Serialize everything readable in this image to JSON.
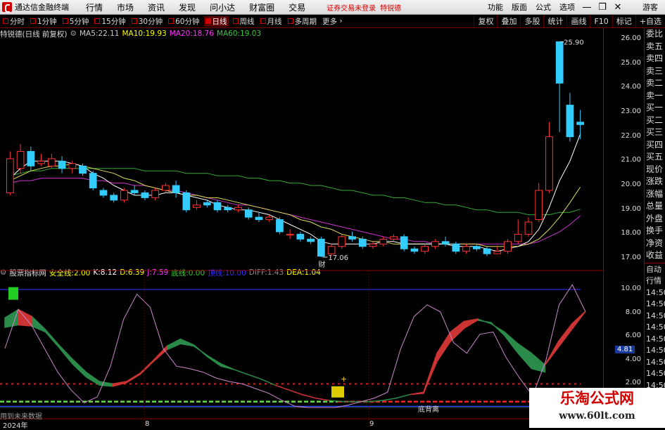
{
  "app": {
    "title": "通达信金融终端"
  },
  "menu": [
    "行情",
    "市场",
    "资讯",
    "发现",
    "问小达",
    "财富圈",
    "交易"
  ],
  "login_status": "证券交易未登录",
  "stock_name_top": "特锐德",
  "right_menu": [
    "功能",
    "版面",
    "公式",
    "选项"
  ],
  "window_buttons": [
    "—",
    "❐",
    "✕"
  ],
  "guest": "游客",
  "toolbar": {
    "periods": [
      "分时",
      "1分钟",
      "5分钟",
      "15分钟",
      "30分钟",
      "60分钟",
      "日线",
      "周线",
      "月线",
      "多周期",
      "更多"
    ],
    "active": "日线",
    "right": [
      "复权",
      "叠加",
      "多股",
      "统计",
      "画线",
      "F10",
      "标记",
      "+自选"
    ]
  },
  "info": {
    "stock": "特锐德(日线 前复权)",
    "ma": [
      {
        "label": "MA5:",
        "value": "22.11",
        "color": "#ffffff"
      },
      {
        "label": "MA10:",
        "value": "19.93",
        "color": "#ffff00"
      },
      {
        "label": "MA20:",
        "value": "18.76",
        "color": "#ff33ff"
      },
      {
        "label": "MA60:",
        "value": "19.03",
        "color": "#33cc33"
      }
    ]
  },
  "sub_info": {
    "name": "股票指标网",
    "items": [
      {
        "label": "安全线:",
        "value": "2.00",
        "color": "#ffff00"
      },
      {
        "label": "K:",
        "value": "8.12",
        "color": "#ffffff"
      },
      {
        "label": "D:",
        "value": "6.39",
        "color": "#ffff00"
      },
      {
        "label": "J:",
        "value": "7.59",
        "color": "#ff33ff"
      },
      {
        "label": "底线:",
        "value": "0.00",
        "color": "#33cc33"
      },
      {
        "label": "顶线:",
        "value": "10.00",
        "color": "#3333ff"
      },
      {
        "label": "DIFF:",
        "value": "1.43",
        "color": "#888888"
      },
      {
        "label": "DEA:",
        "value": "1.04",
        "color": "#ffff00"
      }
    ]
  },
  "price_axis": [
    "26.00",
    "25.00",
    "24.00",
    "23.00",
    "22.00",
    "21.00",
    "20.00",
    "19.00",
    "18.00",
    "17.00"
  ],
  "indicator_axis": [
    "10.00",
    "8.00",
    "6.00",
    "4.00",
    "2.00"
  ],
  "current_value_badge": "4.81",
  "annotations": {
    "high": "25.90",
    "low": "17.06",
    "marker": "财",
    "divergence": "底背离",
    "bottom_note": "用到未来数据",
    "year": "2024年",
    "month_labels": [
      "8",
      "9"
    ]
  },
  "sidebar_labels": [
    "委比",
    "卖五",
    "卖四",
    "卖三",
    "卖二",
    "卖一",
    "买一",
    "买二",
    "买三",
    "买四",
    "买五",
    "现价",
    "涨跌",
    "涨幅",
    "总量",
    "外盘",
    "换手",
    "净资",
    "收益"
  ],
  "sidebar_times": [
    "自动",
    "行情",
    "14:50",
    "14:50",
    "14:50",
    "14:50",
    "14:50",
    "14:50",
    "14:50",
    "14:50",
    "14:50"
  ],
  "watermark": {
    "title": "乐淘公式网",
    "url": "www.60lt.com"
  },
  "chart_data": {
    "type": "candlestick",
    "y_range": [
      16.8,
      26.3
    ],
    "candles": [
      [
        19.7,
        21.1,
        21.4,
        19.6
      ],
      [
        20.7,
        21.4,
        21.7,
        20.5
      ],
      [
        21.4,
        20.8,
        21.6,
        20.6
      ],
      [
        20.9,
        21.0,
        21.3,
        20.8
      ],
      [
        20.8,
        21.1,
        21.3,
        20.7
      ],
      [
        21.0,
        20.7,
        21.2,
        20.5
      ],
      [
        20.7,
        20.9,
        21.0,
        20.5
      ],
      [
        20.8,
        20.5,
        20.9,
        20.4
      ],
      [
        20.5,
        19.9,
        20.6,
        19.8
      ],
      [
        19.8,
        19.6,
        19.9,
        19.5
      ],
      [
        19.6,
        19.4,
        19.7,
        19.3
      ],
      [
        19.4,
        19.8,
        19.9,
        19.3
      ],
      [
        19.8,
        19.7,
        20.0,
        19.6
      ],
      [
        19.7,
        19.5,
        19.8,
        19.4
      ],
      [
        19.5,
        19.8,
        19.9,
        19.4
      ],
      [
        19.8,
        20.0,
        20.1,
        19.7
      ],
      [
        20.0,
        19.7,
        20.2,
        19.5
      ],
      [
        19.7,
        19.0,
        19.8,
        18.9
      ],
      [
        19.1,
        19.2,
        19.4,
        19.0
      ],
      [
        19.3,
        19.2,
        19.4,
        19.1
      ],
      [
        19.3,
        19.0,
        19.4,
        18.9
      ],
      [
        19.1,
        19.0,
        19.2,
        18.9
      ],
      [
        19.0,
        19.1,
        19.2,
        18.9
      ],
      [
        19.0,
        18.7,
        19.1,
        18.6
      ],
      [
        18.7,
        18.6,
        18.9,
        18.5
      ],
      [
        18.6,
        18.7,
        18.8,
        18.5
      ],
      [
        18.6,
        18.1,
        18.7,
        18.0
      ],
      [
        18.0,
        18.0,
        18.2,
        17.8
      ],
      [
        18.0,
        17.8,
        18.1,
        17.7
      ],
      [
        17.8,
        17.7,
        17.9,
        17.6
      ],
      [
        17.8,
        17.1,
        17.9,
        17.06
      ],
      [
        17.2,
        17.5,
        17.6,
        17.1
      ],
      [
        17.5,
        17.9,
        18.0,
        17.4
      ],
      [
        17.9,
        17.8,
        18.1,
        17.7
      ],
      [
        17.8,
        17.5,
        17.9,
        17.4
      ],
      [
        17.5,
        17.6,
        17.7,
        17.4
      ],
      [
        17.6,
        17.8,
        17.9,
        17.5
      ],
      [
        17.8,
        17.9,
        18.0,
        17.7
      ],
      [
        17.9,
        17.4,
        18.0,
        17.3
      ],
      [
        17.4,
        17.3,
        17.5,
        17.2
      ],
      [
        17.3,
        17.5,
        17.6,
        17.2
      ],
      [
        17.5,
        17.7,
        17.8,
        17.4
      ],
      [
        17.7,
        17.6,
        17.9,
        17.5
      ],
      [
        17.6,
        17.3,
        17.7,
        17.2
      ],
      [
        17.3,
        17.5,
        17.6,
        17.2
      ],
      [
        17.5,
        17.4,
        17.6,
        17.3
      ],
      [
        17.4,
        17.2,
        17.5,
        17.1
      ],
      [
        17.2,
        17.3,
        17.5,
        17.2
      ],
      [
        17.3,
        17.7,
        17.8,
        17.2
      ],
      [
        17.7,
        18.0,
        18.6,
        17.6
      ],
      [
        18.0,
        18.5,
        18.7,
        17.9
      ],
      [
        18.6,
        19.8,
        20.1,
        18.5
      ],
      [
        19.8,
        22.0,
        22.6,
        19.7
      ],
      [
        25.9,
        24.2,
        25.9,
        22.2
      ],
      [
        23.3,
        22.0,
        23.8,
        21.8
      ],
      [
        22.6,
        22.5,
        23.1,
        21.9
      ]
    ],
    "ma5": [
      20.3,
      20.7,
      21.0,
      21.0,
      21.0,
      21.0,
      20.9,
      20.8,
      20.5,
      20.3,
      20.0,
      19.8,
      19.6,
      19.6,
      19.6,
      19.7,
      19.7,
      19.6,
      19.5,
      19.4,
      19.2,
      19.1,
      19.0,
      19.0,
      18.9,
      18.8,
      18.6,
      18.4,
      18.2,
      18.0,
      17.7,
      17.6,
      17.6,
      17.6,
      17.6,
      17.6,
      17.7,
      17.7,
      17.6,
      17.6,
      17.6,
      17.6,
      17.6,
      17.5,
      17.5,
      17.5,
      17.4,
      17.3,
      17.4,
      17.5,
      17.7,
      18.2,
      19.1,
      20.2,
      21.0,
      22.11
    ],
    "ma10": [
      20.2,
      20.4,
      20.6,
      20.7,
      20.8,
      20.8,
      20.9,
      20.8,
      20.7,
      20.6,
      20.5,
      20.3,
      20.2,
      20.0,
      19.9,
      19.8,
      19.7,
      19.6,
      19.6,
      19.5,
      19.5,
      19.4,
      19.3,
      19.2,
      19.1,
      19.0,
      18.9,
      18.8,
      18.6,
      18.5,
      18.3,
      18.2,
      18.0,
      17.9,
      17.8,
      17.7,
      17.7,
      17.6,
      17.6,
      17.6,
      17.6,
      17.6,
      17.6,
      17.6,
      17.6,
      17.6,
      17.5,
      17.5,
      17.5,
      17.5,
      17.6,
      17.8,
      18.2,
      18.7,
      19.3,
      19.93
    ],
    "ma20": [
      20.1,
      20.2,
      20.2,
      20.3,
      20.3,
      20.3,
      20.3,
      20.3,
      20.2,
      20.2,
      20.1,
      20.1,
      20.0,
      20.0,
      19.9,
      19.8,
      19.8,
      19.7,
      19.6,
      19.5,
      19.4,
      19.3,
      19.2,
      19.2,
      19.1,
      19.0,
      18.9,
      18.8,
      18.7,
      18.6,
      18.5,
      18.4,
      18.3,
      18.2,
      18.1,
      18.0,
      17.9,
      17.8,
      17.8,
      17.7,
      17.7,
      17.6,
      17.6,
      17.6,
      17.6,
      17.6,
      17.6,
      17.6,
      17.6,
      17.6,
      17.6,
      17.7,
      17.9,
      18.1,
      18.4,
      18.76
    ],
    "ma60": [
      20.4,
      20.5,
      20.6,
      20.6,
      20.7,
      20.7,
      20.7,
      20.7,
      20.7,
      20.7,
      20.7,
      20.7,
      20.7,
      20.6,
      20.6,
      20.6,
      20.6,
      20.5,
      20.5,
      20.5,
      20.4,
      20.4,
      20.4,
      20.3,
      20.3,
      20.2,
      20.2,
      20.1,
      20.1,
      20.0,
      20.0,
      19.9,
      19.8,
      19.8,
      19.7,
      19.6,
      19.6,
      19.5,
      19.5,
      19.4,
      19.3,
      19.3,
      19.2,
      19.2,
      19.1,
      19.0,
      19.0,
      18.9,
      18.9,
      18.9,
      18.8,
      18.8,
      18.8,
      18.9,
      18.9,
      19.03
    ],
    "indicator": {
      "y_range": [
        0,
        11
      ],
      "upper": [
        7.6,
        8.3,
        7.7,
        6.6,
        5.3,
        4.1,
        3.0,
        2.2,
        2.0,
        2.2,
        2.9,
        4.0,
        5.2,
        5.8,
        5.3,
        4.3,
        3.5,
        3.2,
        2.8,
        2.4,
        1.9,
        1.5,
        1.1,
        0.8,
        0.6,
        0.5,
        0.5,
        0.5,
        0.6,
        0.8,
        1.1,
        1.3,
        4.6,
        6.4,
        7.3,
        7.5,
        7.1,
        6.4,
        5.4,
        4.6,
        3.6,
        5.6,
        7.1,
        8.15
      ],
      "lower": [
        6.8,
        7.0,
        6.9,
        6.4,
        5.1,
        3.7,
        2.6,
        1.9,
        1.8,
        2.1,
        2.8,
        3.9,
        4.9,
        5.4,
        5.2,
        4.4,
        3.7,
        3.2,
        2.8,
        2.4,
        1.9,
        1.5,
        1.1,
        0.8,
        0.6,
        0.5,
        0.5,
        0.5,
        0.6,
        0.8,
        1.1,
        1.2,
        3.9,
        5.6,
        6.7,
        7.4,
        7.2,
        6.1,
        4.6,
        3.3,
        3.0,
        5.0,
        6.4,
        7.6
      ],
      "k": [
        5.0,
        8.3,
        7.0,
        5.0,
        3.0,
        1.5,
        0.4,
        0.9,
        3.5,
        7.5,
        9.6,
        8.5,
        5.0,
        3.5,
        3.3,
        3.0,
        2.5,
        2.2,
        2.0,
        1.6,
        1.2,
        0.6,
        0.1,
        0.0,
        0.0,
        0.0,
        0.2,
        0.5,
        0.8,
        1.3,
        5.0,
        7.7,
        8.7,
        8.1,
        5.5,
        4.6,
        6.2,
        6.4,
        4.2,
        2.5,
        1.0,
        4.0,
        8.7,
        10.4,
        8.12
      ],
      "green_spans": [
        [
          0,
          1
        ],
        [
          2,
          8
        ],
        [
          12,
          20
        ],
        [
          24,
          30
        ],
        [
          35,
          40
        ]
      ],
      "red_spans": [
        [
          1,
          2
        ],
        [
          8,
          12
        ],
        [
          20,
          24
        ],
        [
          30,
          35
        ],
        [
          40,
          44
        ]
      ]
    }
  }
}
